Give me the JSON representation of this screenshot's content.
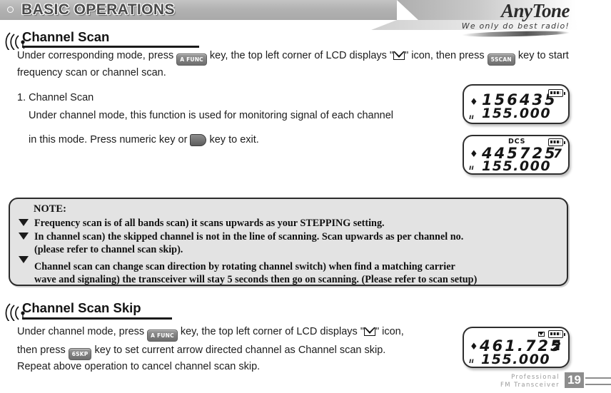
{
  "header": {
    "title": "BASIC OPERATIONS",
    "logo_main": "AnyTone",
    "logo_tagline": "We only do best radio!"
  },
  "sections": [
    {
      "id": "channel-scan",
      "heading": "Channel Scan",
      "intro_part1": "Under corresponding mode, press",
      "key1": "A FUNC",
      "intro_part2": "key, the top left corner of LCD displays \"",
      "icon_label": "envelope-icon",
      "intro_part3": "\" icon, then press",
      "key2": "5SCAN",
      "intro_part4": "key to start frequency scan or channel scan.",
      "item_number": "1. Channel Scan",
      "item_line1": "Under channel mode, this function is used for monitoring signal of each channel",
      "item_line2_a": "in this mode. Press numeric key or",
      "item_key": "ptt-key",
      "item_line2_b": "key to exit."
    },
    {
      "id": "channel-scan-skip",
      "heading": "Channel Scan Skip",
      "intro_part1": "Under channel mode, press",
      "key1": "A FUNC",
      "intro_part2": "key, the top left corner of LCD displays \"",
      "intro_part3": "\" icon,",
      "line2_a": "then press",
      "key2": "6SKP",
      "line2_b": "key to set current arrow directed channel as Channel scan skip.",
      "line3": "Repeat above operation to cancel channel scan skip."
    }
  ],
  "note": {
    "title": "NOTE:",
    "items": [
      {
        "text": "Frequency scan is of all bands scan) it scans upwards as your STEPPING setting.",
        "cont": ""
      },
      {
        "text": "In channel scan) the skipped channel is not in the line of scanning. Scan upwards as per channel no.",
        "cont": "(please refer to channel scan skip)."
      },
      {
        "text": "Channel scan can change scan direction by rotating channel switch) when find a matching carrier",
        "cont": "wave and signaling) the transceiver will stay 5 seconds then go on scanning. (Please refer to scan setup)"
      }
    ]
  },
  "lcds": [
    {
      "id": "lcd-1",
      "main": "156435",
      "sub": "155.000",
      "arrow": "♦",
      "corner": "ıı",
      "dcs": "",
      "mem": "",
      "battery": "battery-icon",
      "envelope": ""
    },
    {
      "id": "lcd-2",
      "main": "445725",
      "sub": "155.000",
      "arrow": "♦",
      "corner": "ıı",
      "dcs": "DCS",
      "mem": "7",
      "battery": "battery-icon",
      "envelope": ""
    },
    {
      "id": "lcd-3",
      "main": "461.725",
      "sub": "155.000",
      "arrow": "♦",
      "corner": "ıı",
      "dcs": "",
      "mem": "2",
      "battery": "battery-icon",
      "envelope": "envelope-icon"
    }
  ],
  "footer": {
    "line1": "Professional",
    "line2": "FM Transceiver",
    "page": "19"
  },
  "colors": {
    "header_bar": "#b2b2b2",
    "note_bg": "#e3e3e3",
    "key_chip": "#808080",
    "footer_gray": "#8d8d8d"
  }
}
